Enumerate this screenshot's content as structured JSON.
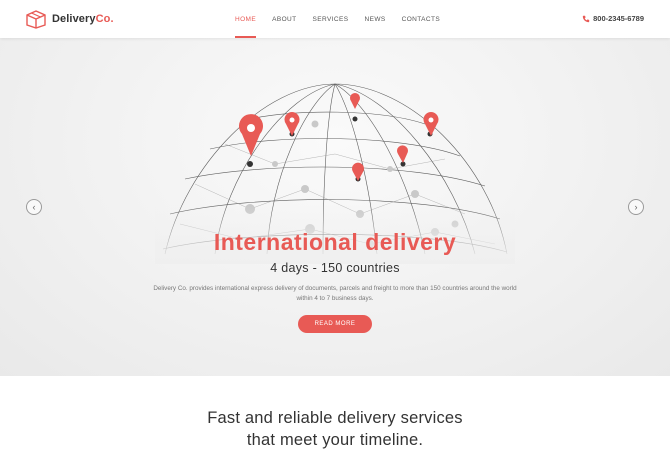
{
  "header": {
    "logo_text_main": "Delivery",
    "logo_text_accent": "Co.",
    "nav": [
      "HOME",
      "ABOUT",
      "SERVICES",
      "NEWS",
      "CONTACTS"
    ],
    "active_nav": "HOME",
    "phone": "800-2345-6789",
    "icons": {
      "logo": "box-icon",
      "phone": "phone-icon"
    }
  },
  "hero": {
    "title": "International delivery",
    "subtitle": "4 days - 150 countries",
    "description": "Delivery Co. provides international express delivery of documents, parcels and freight to more than 150 countries around the world within 4 to 7 business days.",
    "button": "READ MORE",
    "prev_arrow": "‹",
    "next_arrow": "›"
  },
  "section": {
    "title_line1": "Fast and reliable delivery services",
    "title_line2": "that meet your timeline."
  },
  "colors": {
    "accent": "#e85a55",
    "text": "#333333",
    "hero_bg": "#f1f1f1"
  }
}
